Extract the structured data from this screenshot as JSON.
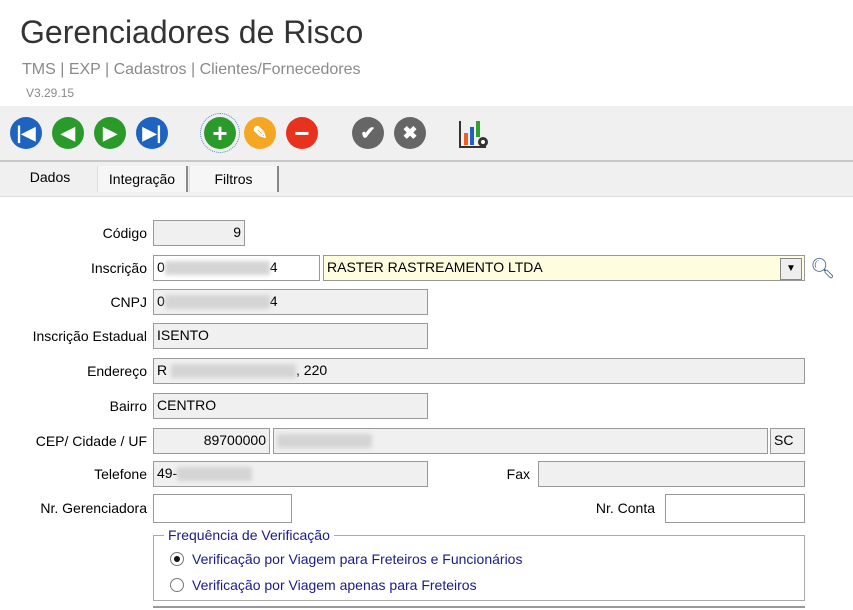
{
  "header": {
    "title": "Gerenciadores de Risco",
    "breadcrumb": "TMS | EXP | Cadastros | Clientes/Fornecedores",
    "version": "V3.29.15"
  },
  "toolbar": {
    "icons": [
      "first-record",
      "previous-record",
      "next-record",
      "last-record",
      "add",
      "edit",
      "delete",
      "confirm",
      "cancel",
      "report-settings"
    ],
    "colors": {
      "blue": "#1e63c0",
      "green": "#2a9a2a",
      "orange": "#f5a623",
      "red": "#e8321e",
      "gray": "#666666"
    }
  },
  "tabs": [
    {
      "label": "Dados"
    },
    {
      "label": "Integração"
    },
    {
      "label": "Filtros"
    }
  ],
  "form": {
    "codigo": {
      "label": "Código",
      "value": "9"
    },
    "inscricao": {
      "label": "Inscrição",
      "prefix": "0",
      "suffix": "4",
      "name": "RASTER RASTREAMENTO LTDA"
    },
    "cnpj": {
      "label": "CNPJ",
      "prefix": "0",
      "suffix": "4"
    },
    "ie": {
      "label": "Inscrição Estadual",
      "value": "ISENTO"
    },
    "endereco": {
      "label": "Endereço",
      "prefix": "R",
      "suffix": ", 220"
    },
    "bairro": {
      "label": "Bairro",
      "value": "CENTRO"
    },
    "cep": {
      "label": "CEP/ Cidade / UF",
      "cep": "89700000",
      "uf": "SC"
    },
    "telefone": {
      "label": "Telefone",
      "prefix": "49-"
    },
    "fax": {
      "label": "Fax",
      "value": ""
    },
    "nr_gerenciadora": {
      "label": "Nr. Gerenciadora",
      "value": ""
    },
    "nr_conta": {
      "label": "Nr. Conta",
      "value": ""
    }
  },
  "frequencia": {
    "title": "Frequência de Verificação",
    "options": [
      "Verificação por Viagem para Freteiros e Funcionários",
      "Verificação por Viagem apenas para Freteiros"
    ],
    "selected": 0
  }
}
